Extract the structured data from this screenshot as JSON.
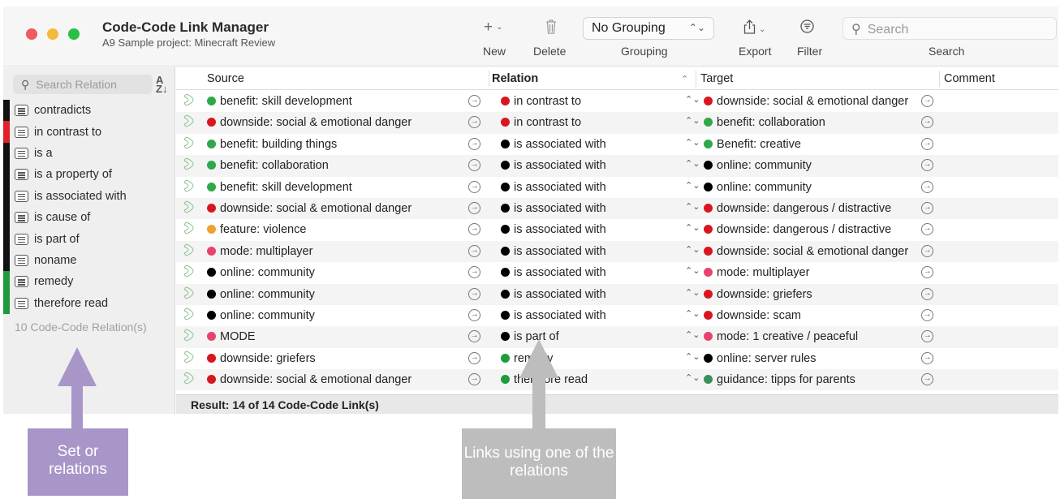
{
  "window": {
    "title": "Code-Code Link Manager",
    "subtitle": "A9 Sample project: Minecraft Review"
  },
  "toolbar": {
    "new_label": "New",
    "delete_label": "Delete",
    "grouping_label": "Grouping",
    "grouping_value": "No Grouping",
    "export_label": "Export",
    "filter_label": "Filter",
    "search_label": "Search",
    "search_placeholder": "Search"
  },
  "sidebar": {
    "search_placeholder": "Search Relation",
    "items": [
      {
        "label": "contradicts",
        "color": "#111111"
      },
      {
        "label": "in contrast to",
        "color": "#e0202a"
      },
      {
        "label": "is a",
        "color": "#111111"
      },
      {
        "label": "is a property of",
        "color": "#111111"
      },
      {
        "label": "is associated with",
        "color": "#111111"
      },
      {
        "label": "is cause of",
        "color": "#111111"
      },
      {
        "label": "is part of",
        "color": "#111111"
      },
      {
        "label": "noname",
        "color": "#111111"
      },
      {
        "label": "remedy",
        "color": "#1f9a3c"
      },
      {
        "label": "therefore read",
        "color": "#1f9a3c"
      }
    ],
    "count_label": "10 Code-Code Relation(s)"
  },
  "table": {
    "columns": {
      "source": "Source",
      "relation": "Relation",
      "target": "Target",
      "comment": "Comment"
    },
    "rows": [
      {
        "source": "benefit: skill development",
        "source_color": "#2fa84a",
        "relation": "in contrast to",
        "relation_color": "#d9161f",
        "target": "downside: social & emotional danger",
        "target_color": "#d9161f"
      },
      {
        "source": "downside: social & emotional danger",
        "source_color": "#d9161f",
        "relation": "in contrast to",
        "relation_color": "#d9161f",
        "target": "benefit: collaboration",
        "target_color": "#2fa84a"
      },
      {
        "source": "benefit: building things",
        "source_color": "#2fa84a",
        "relation": "is associated with",
        "relation_color": "#000000",
        "target": "Benefit: creative",
        "target_color": "#2fa84a"
      },
      {
        "source": "benefit: collaboration",
        "source_color": "#2fa84a",
        "relation": "is associated with",
        "relation_color": "#000000",
        "target": "online: community",
        "target_color": "#000000"
      },
      {
        "source": "benefit: skill development",
        "source_color": "#2fa84a",
        "relation": "is associated with",
        "relation_color": "#000000",
        "target": "online: community",
        "target_color": "#000000"
      },
      {
        "source": "downside: social & emotional danger",
        "source_color": "#d9161f",
        "relation": "is associated with",
        "relation_color": "#000000",
        "target": "downside: dangerous / distractive",
        "target_color": "#d9161f"
      },
      {
        "source": "feature: violence",
        "source_color": "#f0a030",
        "relation": "is associated with",
        "relation_color": "#000000",
        "target": "downside: dangerous / distractive",
        "target_color": "#d9161f"
      },
      {
        "source": "mode: multiplayer",
        "source_color": "#e8436f",
        "relation": "is associated with",
        "relation_color": "#000000",
        "target": "downside: social & emotional danger",
        "target_color": "#d9161f"
      },
      {
        "source": "online: community",
        "source_color": "#000000",
        "relation": "is associated with",
        "relation_color": "#000000",
        "target": "mode: multiplayer",
        "target_color": "#e8436f"
      },
      {
        "source": "online: community",
        "source_color": "#000000",
        "relation": "is associated with",
        "relation_color": "#000000",
        "target": "downside: griefers",
        "target_color": "#d9161f"
      },
      {
        "source": "online: community",
        "source_color": "#000000",
        "relation": "is associated with",
        "relation_color": "#000000",
        "target": "downside: scam",
        "target_color": "#d9161f"
      },
      {
        "source": "MODE",
        "source_color": "#e8436f",
        "relation": "is part of",
        "relation_color": "#000000",
        "target": "mode: 1 creative / peaceful",
        "target_color": "#e8436f"
      },
      {
        "source": "downside: griefers",
        "source_color": "#d9161f",
        "relation": "remedy",
        "relation_color": "#1f9a3c",
        "target": "online: server rules",
        "target_color": "#000000"
      },
      {
        "source": "downside: social & emotional danger",
        "source_color": "#d9161f",
        "relation": "therefore read",
        "relation_color": "#1f9a3c",
        "target": "guidance: tipps for parents",
        "target_color": "#3a8f5a"
      }
    ],
    "result_label": "Result: 14 of 14 Code-Code Link(s)"
  },
  "annotations": {
    "left_box": "Set or relations",
    "right_box": "Links using one of the relations",
    "left_color": "#a896c8",
    "right_color": "#bdbdbd"
  }
}
